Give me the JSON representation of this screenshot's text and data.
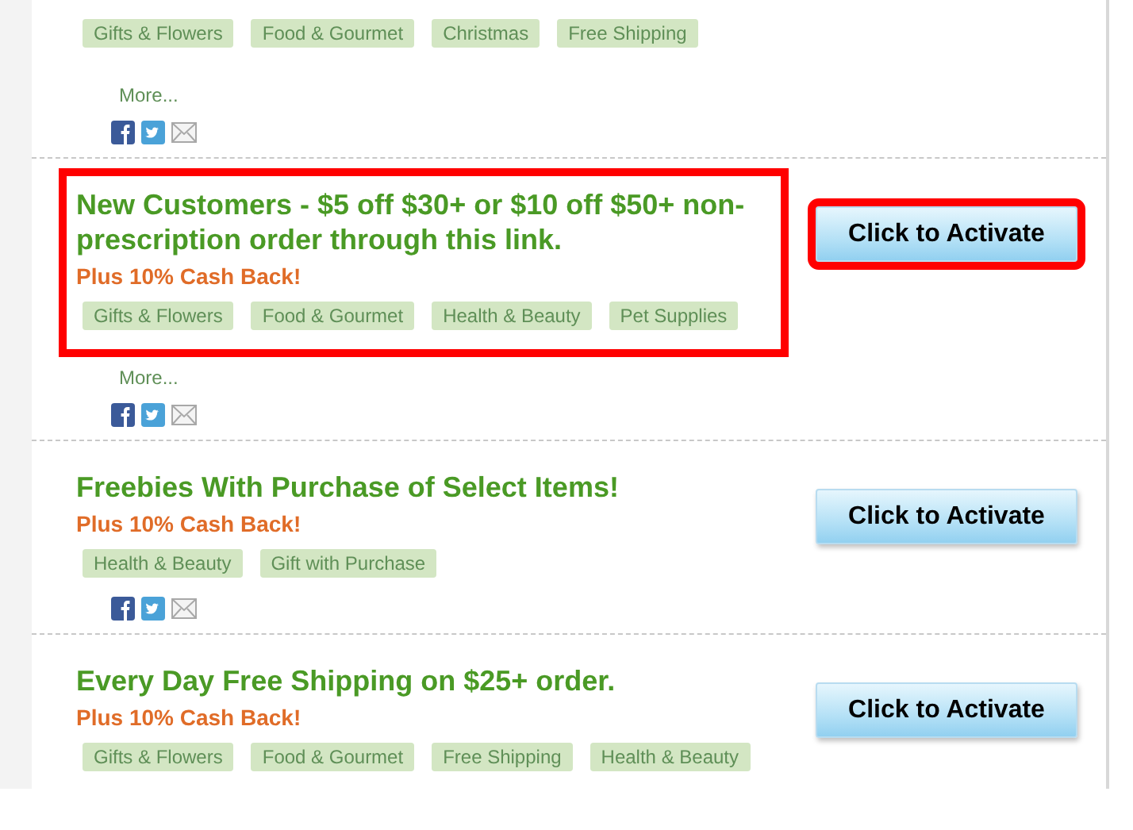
{
  "offers": [
    {
      "tags": [
        "Gifts & Flowers",
        "Food & Gourmet",
        "Christmas",
        "Free Shipping"
      ],
      "more": "More...",
      "share_icons": true,
      "highlighted": false
    },
    {
      "title": "New Customers - $5 off $30+ or $10 off $50+ non-prescription order through this link.",
      "cashback": "Plus 10% Cash Back!",
      "tags": [
        "Gifts & Flowers",
        "Food & Gourmet",
        "Health & Beauty",
        "Pet Supplies"
      ],
      "more": "More...",
      "share_icons": true,
      "button": "Click to Activate",
      "highlighted": true
    },
    {
      "title": "Freebies With Purchase of Select Items!",
      "cashback": "Plus 10% Cash Back!",
      "tags": [
        "Health & Beauty",
        "Gift with Purchase"
      ],
      "share_icons": true,
      "button": "Click to Activate",
      "highlighted": false
    },
    {
      "title": "Every Day Free Shipping on $25+ order.",
      "cashback": "Plus 10% Cash Back!",
      "tags": [
        "Gifts & Flowers",
        "Food & Gourmet",
        "Free Shipping",
        "Health & Beauty"
      ],
      "share_icons": false,
      "button": "Click to Activate",
      "highlighted": false
    }
  ]
}
